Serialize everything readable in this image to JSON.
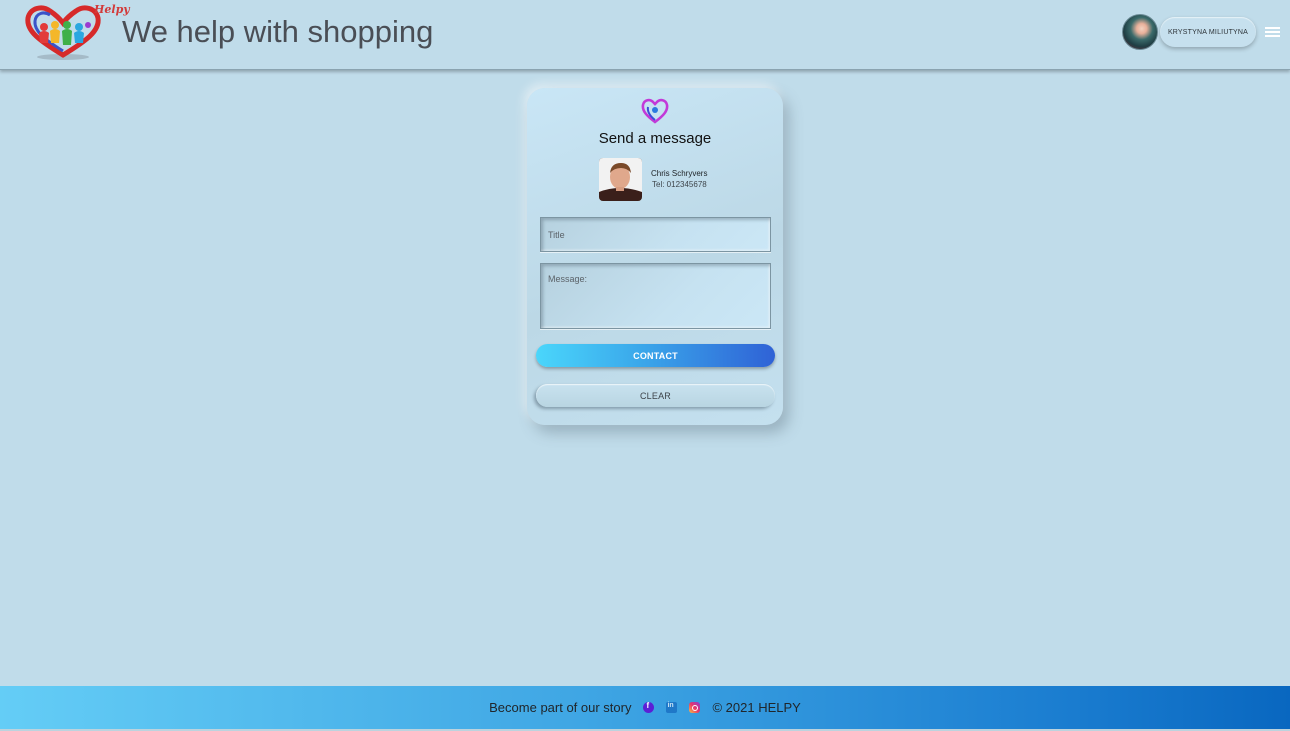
{
  "header": {
    "logo_text": "Helpy",
    "title": "We help with shopping",
    "user_name": "KRYSTYNA MILIUTYNA",
    "menu_icon": "hamburger-icon"
  },
  "card": {
    "title": "Send a message",
    "contact": {
      "name": "Chris Schryvers",
      "tel": "Tel: 012345678"
    },
    "fields": {
      "title_placeholder": "Title",
      "message_placeholder": "Message:"
    },
    "buttons": {
      "contact": "CONTACT",
      "clear": "CLEAR"
    }
  },
  "footer": {
    "text": "Become part of our story",
    "social": [
      "facebook-icon",
      "linkedin-icon",
      "instagram-icon"
    ],
    "copyright": "© 2021 HELPY"
  },
  "colors": {
    "background": "#c0dcea",
    "contact_button_start": "#4ad6fb",
    "contact_button_end": "#2f62d6",
    "footer_start": "#64cdf6",
    "footer_end": "#0967c0"
  }
}
